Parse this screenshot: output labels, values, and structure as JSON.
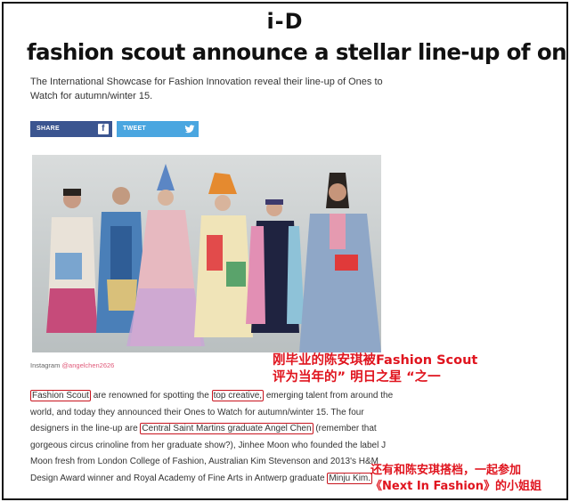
{
  "site": {
    "logo": "i-D"
  },
  "article": {
    "headline": "fashion scout announce a stellar line-up of ones to watch",
    "standfirst": "The International Showcase for Fashion Innovation reveal their line-up of Ones to Watch for autumn/winter 15."
  },
  "share": {
    "facebook_label": "SHARE",
    "twitter_label": "TWEET",
    "facebook_icon": "f"
  },
  "photo_credit": {
    "prefix": "Instagram ",
    "handle": "@angelchen2626"
  },
  "body": {
    "t1": "Fashion Scout",
    "t2": " are renowned for spotting the ",
    "t3": "top creative,",
    "t4": " emerging talent from around the world, and today they announced their Ones to Watch for autumn/winter 15. The four designers in the line-up are ",
    "t5": "Central Saint Martins graduate Angel Chen",
    "t6": " (remember that gorgeous circus crinoline from her graduate show?), Jinhee Moon who founded the label J Moon fresh from London College of Fashion, Australian Kim Stevenson and 2013's H&M Design Award winner and Royal Academy of Fine Arts in Antwerp graduate ",
    "t7": "Minju Kim."
  },
  "annotations": {
    "note1_line1": "刚毕业的陈安琪被Fashion Scout",
    "note1_line2": "评为当年的” 明日之星 “之一",
    "note2_line1": "还有和陈安琪搭档，一起参加",
    "note2_line2": "《Next In Fashion》的小姐姐"
  },
  "colors": {
    "facebook": "#3b5590",
    "twitter": "#4aa6e0",
    "annotation_red": "#e0141e",
    "credit_handle": "#e05a7a"
  }
}
